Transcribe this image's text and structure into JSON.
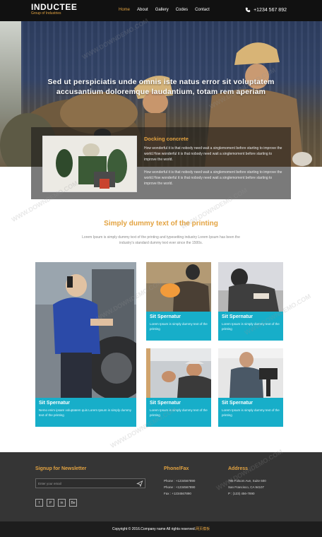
{
  "header": {
    "logo_name": "INDUCTEE",
    "logo_sub": "Group of Industries",
    "nav": [
      "Home",
      "About",
      "Gallery",
      "Codes",
      "Contact"
    ],
    "phone": "+1234 567 892"
  },
  "hero": {
    "title": "Sed ut perspiciatis unde omnis iste natus error sit voluptatem accusantium doloremque laudantium, totam rem aperiam"
  },
  "dock": {
    "title": "Docking concrete",
    "paragraphs": [
      "How wonderful it is that nobody need wait a singlemoment before starting to improve the world.How wonderful it is that nobody need wait a singlemoment before starting to improve the world.",
      "How wonderful it is that nobody need wait a singlemoment before starting to improve the world.How wonderful it is that nobody need wait a singlemoment before starting to improve the world."
    ]
  },
  "section": {
    "title": "Simply dummy text of the printing",
    "subtitle": "Lorem Ipsum is simply dummy text of the printing and typesetting industry Lorem Ipsum has been the industry's standard dummy text ever since the 1500s."
  },
  "cards": [
    {
      "title": "Sit Spernatur",
      "text": "Nemo enim ipsam voluptatem quis Lorem Ipsum is simply dummy text of the printing"
    },
    {
      "title": "Sit Spernatur",
      "text": "Lorem Ipsum is simply dummy text of the printing"
    },
    {
      "title": "Sit Spernatur",
      "text": "Lorem Ipsum is simply dummy text of the printing"
    },
    {
      "title": "Sit Spernatur",
      "text": "Lorem Ipsum is simply dummy text of the printing"
    },
    {
      "title": "Sit Spernatur",
      "text": "Lorem Ipsum is simply dummy text of the printing"
    }
  ],
  "footer": {
    "newsletter_title": "Signup for Newsletter",
    "newsletter_placeholder": "Enter your email",
    "socials": [
      "f",
      "P",
      "in",
      "Be"
    ],
    "phone_title": "Phone/Fax",
    "phone_lines": [
      "Phone : +1234567890",
      "Phone : +1234567890",
      "Fax : +1234567890"
    ],
    "address_title": "Address",
    "address_lines": [
      "795 Folsom Ave, Suite 600",
      "San Francisco, CA 94107",
      "P : (123) 456-7890"
    ],
    "copyright": "Copyright © 2016.Company name All rights reserved.",
    "copyright_link": "网页模板"
  },
  "watermark": "WWW.DOWNDEMO.COM",
  "colors": {
    "accent": "#e3a341",
    "card_caption": "#17aec9",
    "header_bg": "#111111",
    "footer_bg": "#353535"
  }
}
